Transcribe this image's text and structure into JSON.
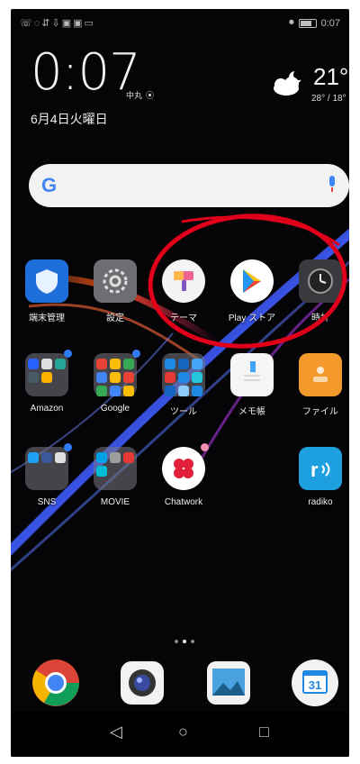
{
  "status": {
    "left_icons": "☏◌⇵⇩▣▣▭",
    "right_text": "0:07"
  },
  "clock": {
    "time": "0:07",
    "location": "中丸",
    "date": "6月4日火曜日"
  },
  "weather": {
    "temp": "21°",
    "hilo": "28° / 18°"
  },
  "search": {
    "logo": "G"
  },
  "row1": [
    {
      "label": "端末管理",
      "icon": "shield-icon",
      "color": "#1e88e5"
    },
    {
      "label": "設定",
      "icon": "gear-icon",
      "color": "#888888"
    },
    {
      "label": "テーマ",
      "icon": "brush-icon",
      "color": "#f0f0f0"
    },
    {
      "label": "Play ストア",
      "icon": "play-store-icon",
      "color": "#ffffff"
    },
    {
      "label": "時計",
      "icon": "clock-icon",
      "color": "#333333"
    }
  ],
  "row2": [
    {
      "label": "Amazon",
      "icon": "folder-icon"
    },
    {
      "label": "Google",
      "icon": "folder-icon"
    },
    {
      "label": "ツール",
      "icon": "folder-icon"
    },
    {
      "label": "メモ帳",
      "icon": "notepad-icon"
    },
    {
      "label": "ファイル",
      "icon": "files-icon"
    }
  ],
  "row3": [
    {
      "label": "SNS",
      "icon": "folder-icon"
    },
    {
      "label": "MOVIE",
      "icon": "folder-icon"
    },
    {
      "label": "Chatwork",
      "icon": "chatwork-icon"
    },
    {
      "label": "radiko",
      "icon": "radiko-icon"
    }
  ],
  "dock": [
    {
      "name": "chrome-icon"
    },
    {
      "name": "camera-icon"
    },
    {
      "name": "gallery-icon"
    },
    {
      "name": "calendar-icon",
      "text": "31"
    }
  ],
  "nav": {
    "back": "◁",
    "home": "○",
    "recent": "□"
  }
}
